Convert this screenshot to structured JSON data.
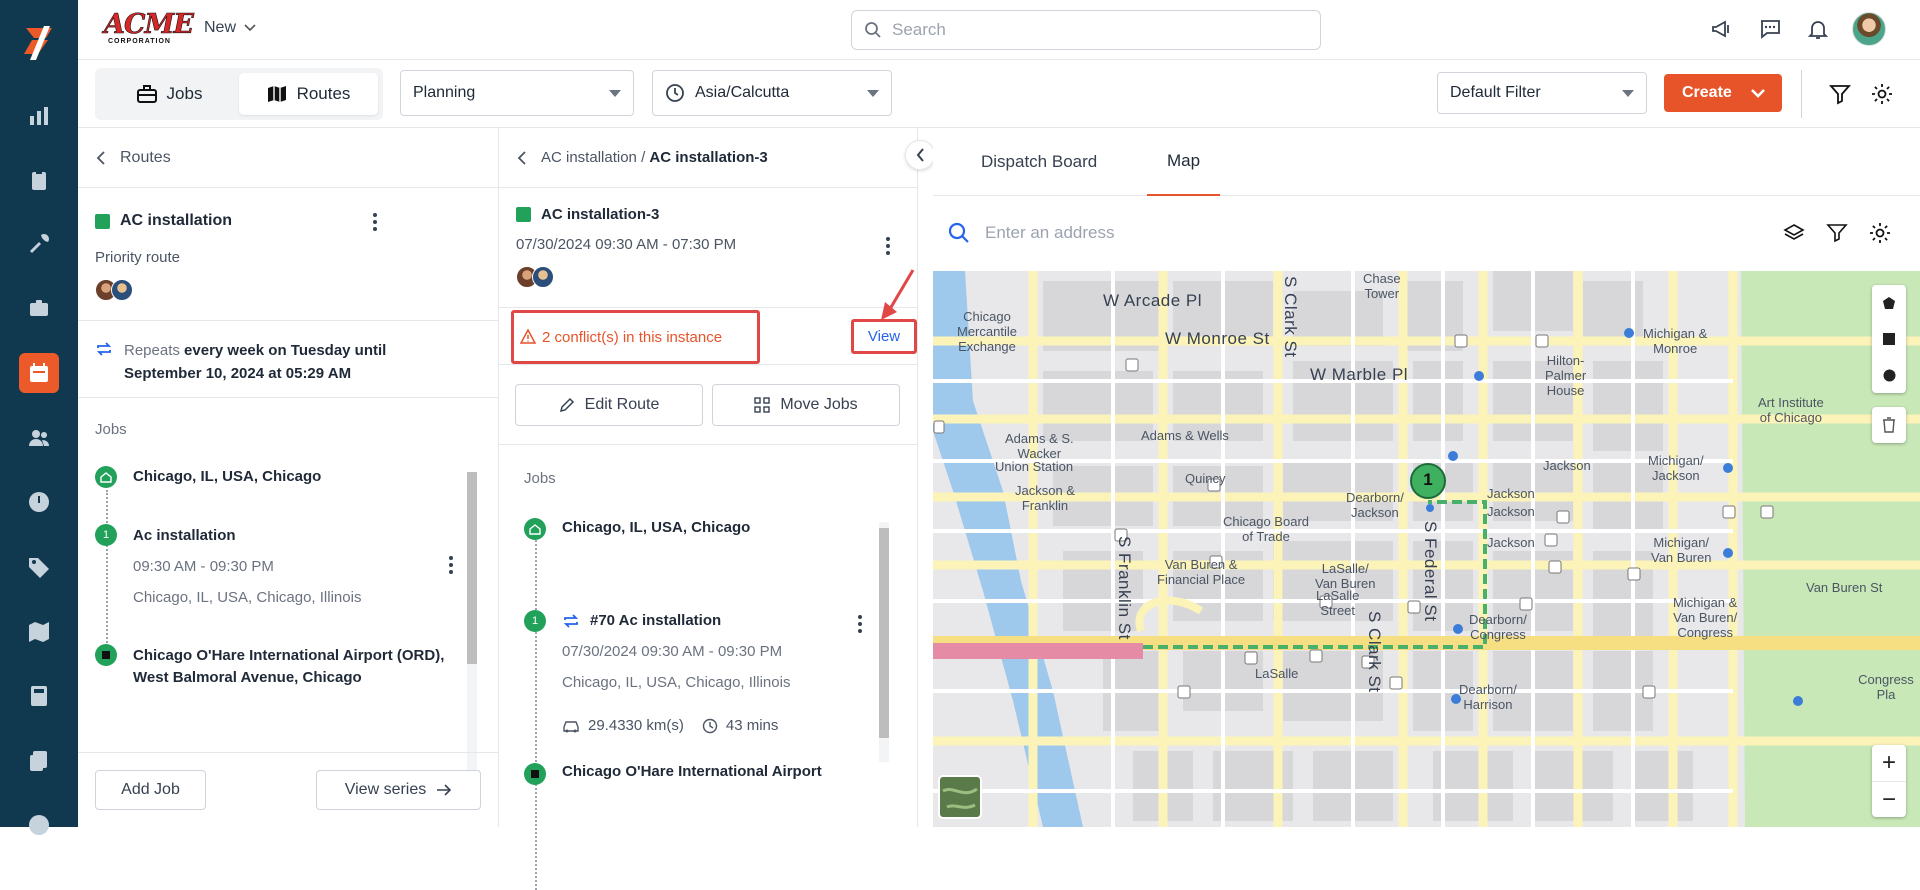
{
  "brand": {
    "name": "ACME",
    "sub": "CORPORATION"
  },
  "topbar": {
    "new_label": "New",
    "search_placeholder": "Search"
  },
  "subbar": {
    "jobs_tab": "Jobs",
    "routes_tab": "Routes",
    "planning": "Planning",
    "timezone": "Asia/Calcutta",
    "filter": "Default Filter",
    "create": "Create"
  },
  "left": {
    "back": "Routes",
    "route_name": "AC installation",
    "priority": "Priority route",
    "repeats_label": "Repeats",
    "repeats_value": "every week on Tuesday until",
    "repeats_until": "September 10, 2024 at 05:29 AM",
    "jobs_header": "Jobs",
    "jobs": [
      {
        "marker": "home",
        "title": "Chicago, IL, USA, Chicago"
      },
      {
        "marker": "1",
        "title": "Ac installation",
        "time": "09:30 AM - 09:30 PM",
        "address": "Chicago, IL, USA, Chicago, Illinois"
      },
      {
        "marker": "end",
        "title": "Chicago O'Hare International Airport (ORD),",
        "title2": "West Balmoral Avenue, Chicago"
      }
    ],
    "add_job": "Add Job",
    "view_series": "View series"
  },
  "mid": {
    "crumb_parent": "AC installation",
    "crumb_sep": "/",
    "crumb_current": "AC installation-3",
    "instance_name": "AC installation-3",
    "instance_time": "07/30/2024 09:30 AM - 07:30 PM",
    "conflict": "2 conflict(s) in this instance",
    "view": "View",
    "edit_route": "Edit Route",
    "move_jobs": "Move Jobs",
    "jobs_header": "Jobs",
    "jobs": [
      {
        "marker": "home",
        "title": "Chicago, IL, USA, Chicago"
      },
      {
        "marker": "1",
        "title": "#70 Ac installation",
        "time": "07/30/2024 09:30 AM - 09:30 PM",
        "address": "Chicago, IL, USA, Chicago, Illinois",
        "distance": "29.4330 km(s)",
        "duration": "43 mins"
      },
      {
        "marker": "end",
        "title": "Chicago O'Hare International Airport"
      }
    ]
  },
  "right": {
    "tabs": [
      "Dispatch Board",
      "Map"
    ],
    "active_tab": "Map",
    "address_placeholder": "Enter an address",
    "map_labels": {
      "chase": "Chase\nTower",
      "merc": "Chicago\nMercantile\nExchange",
      "arcade": "W Arcade Pl",
      "monroe": "W Monroe St",
      "clark": "S Clark St",
      "marble": "W Marble Pl",
      "michmonroe": "Michigan &\nMonroe",
      "hilton": "Hilton-\nPalmer\nHouse",
      "artinst": "Art Institute\nof Chicago",
      "adams_wacker": "Adams & S.\nWacker",
      "adams_wells": "Adams & Wells",
      "union": "Union Station",
      "quincy": "Quincy",
      "jackson_franklin": "Jackson &\nFranklin",
      "dearborn": "Dearborn/\nJackson",
      "jackson1": "Jackson",
      "jackson2": "Jackson",
      "jackson3": "Jackson",
      "jackson4": "Jackson",
      "michjackson": "Michigan/\nJackson",
      "cbot": "Chicago Board\nof Trade",
      "franklin": "S Franklin St",
      "federal": "S Federal St",
      "vanburen_fin": "Van Buren &\nFinancial Place",
      "lasalle_vb": "LaSalle/\nVan Buren",
      "lasalle_st": "LaSalle\nStreet",
      "dearborn_congress": "Dearborn/\nCongress",
      "michvb": "Michigan/\nVan Buren",
      "vbst": "Van Buren St",
      "michvbc": "Michigan &\nVan Buren/\nCongress",
      "clark2": "S Clark St",
      "lasalle": "LaSalle",
      "dearborn_harrison": "Dearborn/\nHarrison",
      "congress_pl": "Congress Pla",
      "marker": "1"
    },
    "zoom_in": "+",
    "zoom_out": "−"
  },
  "colors": {
    "rail": "#10394f",
    "accent": "#e8542a",
    "green": "#22a15a",
    "conflict": "#e8542a",
    "view": "#2563eb"
  },
  "icons": [
    "logo-icon",
    "dashboard-icon",
    "clipboard-icon",
    "tools-icon",
    "briefcase-icon",
    "calendar-icon",
    "people-icon",
    "clock-icon",
    "tag-icon",
    "map-icon",
    "calculator-icon",
    "docs-icon"
  ]
}
